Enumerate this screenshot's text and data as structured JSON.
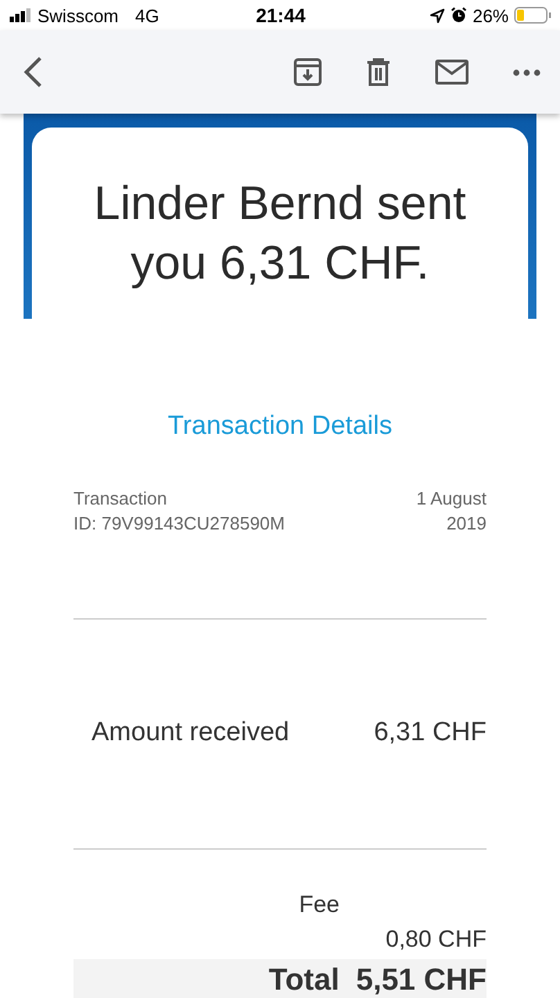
{
  "status_bar": {
    "carrier": "Swisscom",
    "network": "4G",
    "time": "21:44",
    "battery": "26%"
  },
  "message": {
    "headline": "Linder Bernd sent you 6,31 CHF.",
    "details_link": "Transaction Details",
    "transaction_label": "Transaction",
    "transaction_id": "ID: 79V99143CU278590M",
    "date": "1 August 2019",
    "rows": [
      {
        "kind": "amount",
        "label": "Amount received",
        "value": "6,31 CHF"
      },
      {
        "kind": "fee",
        "label": "Fee",
        "value": "0,80 CHF"
      },
      {
        "kind": "total",
        "label": "Total",
        "value": "5,51 CHF"
      }
    ]
  }
}
